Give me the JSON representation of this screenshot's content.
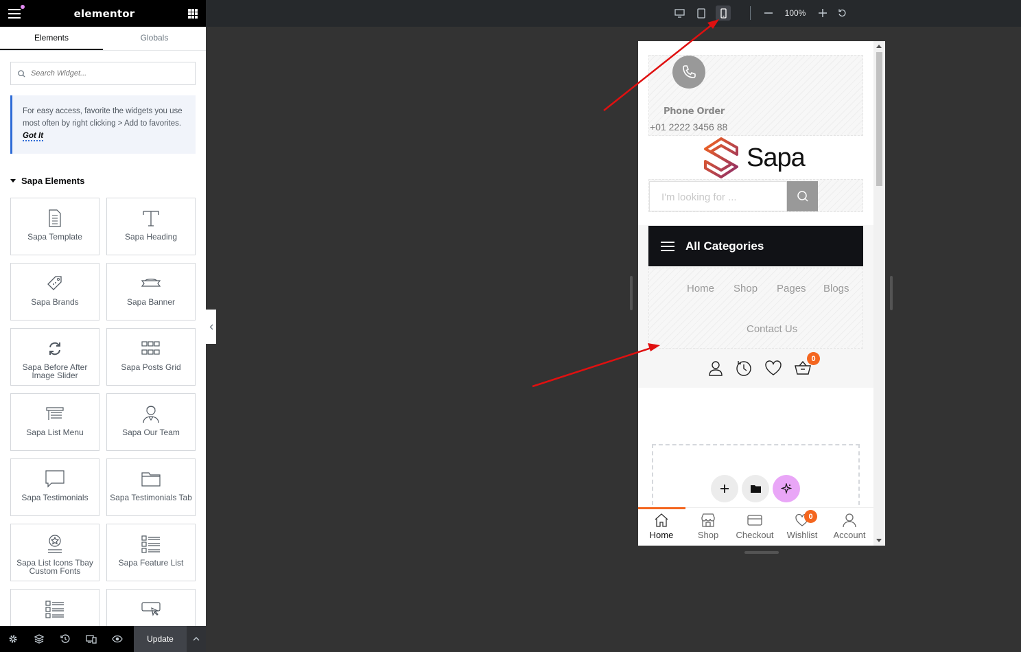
{
  "panel": {
    "logo": "elementor",
    "tabs": [
      "Elements",
      "Globals"
    ],
    "search_placeholder": "Search Widget...",
    "notice_text": "For easy access, favorite the widgets you use most often by right clicking > Add to favorites.",
    "notice_link": "Got It",
    "section_title": "Sapa Elements",
    "widgets": [
      {
        "label": "Sapa Template",
        "icon": "document-icon"
      },
      {
        "label": "Sapa Heading",
        "icon": "heading-icon"
      },
      {
        "label": "Sapa Brands",
        "icon": "tag-icon"
      },
      {
        "label": "Sapa Banner",
        "icon": "banner-icon"
      },
      {
        "label": "Sapa Before After Image Slider",
        "icon": "sync-icon"
      },
      {
        "label": "Sapa Posts Grid",
        "icon": "posts-grid-icon"
      },
      {
        "label": "Sapa List Menu",
        "icon": "list-menu-icon"
      },
      {
        "label": "Sapa Our Team",
        "icon": "team-icon"
      },
      {
        "label": "Sapa Testimonials",
        "icon": "speech-bubble-icon"
      },
      {
        "label": "Sapa Testimonials Tab",
        "icon": "folder-tab-icon"
      },
      {
        "label": "Sapa List Icons Tbay Custom Fonts",
        "icon": "star-badge-icon"
      },
      {
        "label": "Sapa Feature List",
        "icon": "feature-list-icon"
      },
      {
        "label": "",
        "icon": "feature-list-icon"
      },
      {
        "label": "",
        "icon": "pointer-box-icon"
      }
    ],
    "footer": {
      "update_label": "Update"
    }
  },
  "topbar": {
    "zoom": "100%"
  },
  "preview": {
    "phone_title": "Phone Order",
    "phone_number": "+01 2222 3456 88",
    "brand_name": "Sapa",
    "search_placeholder": "I'm looking for ...",
    "categories_label": "All Categories",
    "menu": [
      "Home",
      "Shop",
      "Pages",
      "Blogs",
      "Contact Us"
    ],
    "cart_count": "0",
    "wishlist_count": "0",
    "bottom_nav": [
      "Home",
      "Shop",
      "Checkout",
      "Wishlist",
      "Account"
    ]
  },
  "colors": {
    "accent": "#f4661f",
    "dark": "#111216",
    "ai_button": "#e9a6f7"
  }
}
